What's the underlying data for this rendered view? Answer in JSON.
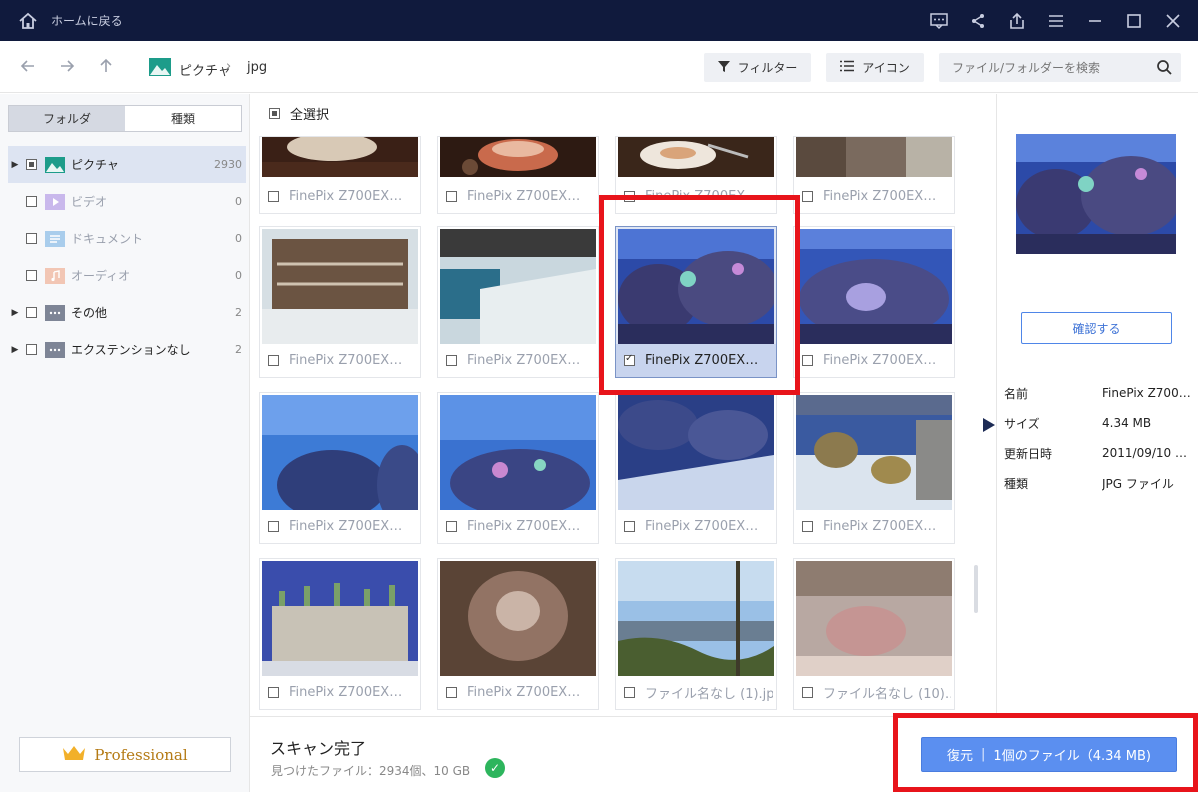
{
  "titlebar": {
    "home_label": "ホームに戻る",
    "icons": [
      "home-icon",
      "feedback-icon",
      "share-icon",
      "export-icon",
      "menu-icon",
      "minimize-icon",
      "maximize-icon",
      "close-icon"
    ]
  },
  "toolbar": {
    "breadcrumb": [
      "ピクチャ",
      "jpg"
    ],
    "filter_label": "フィルター",
    "view_label": "アイコン",
    "search_placeholder": "ファイル/フォルダーを検索"
  },
  "sidebar": {
    "tabs": [
      "フォルダ",
      "種類"
    ],
    "active_tab": 1,
    "items": [
      {
        "label": "ピクチャ",
        "count": "2930",
        "expandable": true,
        "selected": true
      },
      {
        "label": "ビデオ",
        "count": "0",
        "expandable": false
      },
      {
        "label": "ドキュメント",
        "count": "0",
        "expandable": false
      },
      {
        "label": "オーディオ",
        "count": "0",
        "expandable": false
      },
      {
        "label": "その他",
        "count": "2",
        "expandable": true
      },
      {
        "label": "エクステンションなし",
        "count": "2",
        "expandable": true
      }
    ],
    "pro_label": "Professional"
  },
  "main": {
    "select_all_label": "全選択",
    "tiles": [
      {
        "name": "FinePix Z700EX…",
        "checked": false
      },
      {
        "name": "FinePix Z700EX…",
        "checked": false
      },
      {
        "name": "FinePix Z700EX…",
        "checked": false
      },
      {
        "name": "FinePix Z700EX…",
        "checked": false
      },
      {
        "name": "FinePix Z700EX…",
        "checked": false
      },
      {
        "name": "FinePix Z700EX…",
        "checked": false
      },
      {
        "name": "FinePix Z700EX…",
        "checked": true
      },
      {
        "name": "FinePix Z700EX…",
        "checked": false
      },
      {
        "name": "FinePix Z700EX…",
        "checked": false
      },
      {
        "name": "FinePix Z700EX…",
        "checked": false
      },
      {
        "name": "FinePix Z700EX…",
        "checked": false
      },
      {
        "name": "FinePix Z700EX…",
        "checked": false
      },
      {
        "name": "FinePix Z700EX…",
        "checked": false
      },
      {
        "name": "FinePix Z700EX…",
        "checked": false
      },
      {
        "name": "ファイル名なし (1).jpg",
        "checked": false
      },
      {
        "name": "ファイル名なし (10)…",
        "checked": false
      }
    ]
  },
  "preview": {
    "confirm_label": "確認する",
    "props": [
      {
        "key": "名前",
        "value": "FinePix Z700…"
      },
      {
        "key": "サイズ",
        "value": "4.34 MB"
      },
      {
        "key": "更新日時",
        "value": "2011/09/10 …"
      },
      {
        "key": "種類",
        "value": "JPG ファイル"
      }
    ]
  },
  "status": {
    "title": "スキャン完了",
    "summary": "見つけたファイル：2934個、10 GB"
  },
  "recover": {
    "label": "復元",
    "detail": "1個のファイル（4.34 MB)"
  },
  "colors": {
    "titlebar_bg": "#101a3d",
    "accent": "#5b8ff0",
    "highlight": "#e8141b",
    "success": "#2db55d"
  }
}
